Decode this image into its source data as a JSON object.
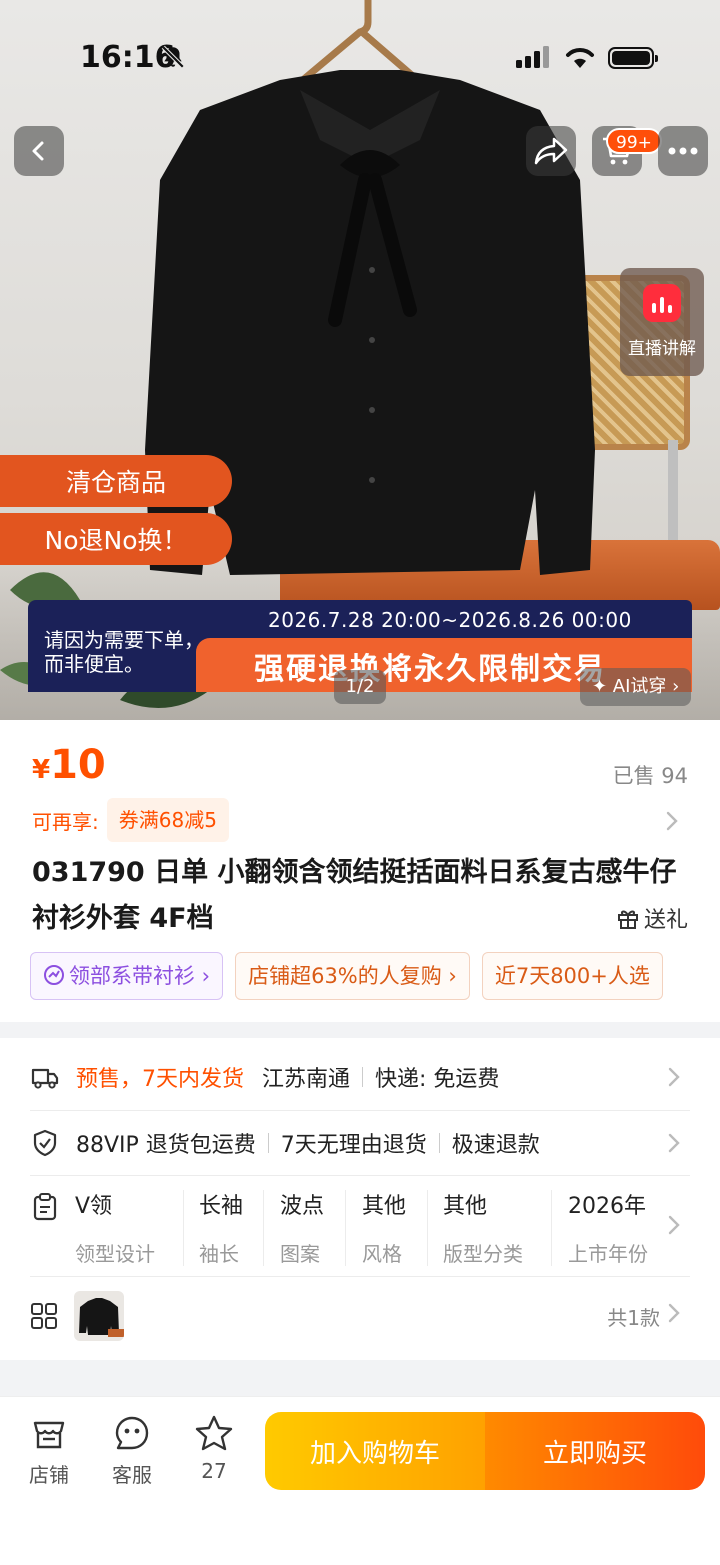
{
  "status_bar": {
    "time": "16:16"
  },
  "hero": {
    "cart_badge": "99+",
    "live_label": "直播讲解",
    "tag_clearance": "清仓商品",
    "tag_no_return": "No退No换！",
    "promo_time": "2026.7.28 20:00~2026.8.26 00:00",
    "promo_left_1": "请因为需要下单，",
    "promo_left_2": "而非便宜。",
    "promo_big": "强硬退换将永久限制交易",
    "page_indicator": "1/2",
    "ai_try": "✦ AI试穿 ›"
  },
  "product": {
    "price_symbol": "¥",
    "price": "10",
    "sold": "已售 94",
    "coupon_label": "可再享:",
    "coupon": "券满68减5",
    "title": "031790 日单 小翻领含领结挺括面料日系复古感牛仔衬衫外套 4F档",
    "gift": "送礼",
    "tags": [
      "领部系带衬衫 ›",
      "店铺超63%的人复购 ›",
      "近7天800+人选"
    ]
  },
  "details": {
    "shipping_status": "预售，7天内发货",
    "shipping_from": "江苏南通",
    "shipping_fee": "快递: 免运费",
    "service_1": "88VIP 退货包运费",
    "service_2": "7天无理由退货",
    "service_3": "极速退款",
    "specs": [
      {
        "value": "V领",
        "key": "领型设计"
      },
      {
        "value": "长袖",
        "key": "袖长"
      },
      {
        "value": "波点",
        "key": "图案"
      },
      {
        "value": "其他",
        "key": "风格"
      },
      {
        "value": "其他",
        "key": "版型分类"
      },
      {
        "value": "2026年",
        "key": "上市年份"
      }
    ],
    "variants_count": "共1款"
  },
  "bottom_bar": {
    "store": "店铺",
    "service": "客服",
    "favorites": "27",
    "add_to_cart": "加入购物车",
    "buy_now": "立即购买"
  },
  "colors": {
    "accent": "#ff5000",
    "cta_cart": "#ffb000",
    "cta_buy": "#ff5a0a",
    "promo_dark": "#1b2158"
  }
}
